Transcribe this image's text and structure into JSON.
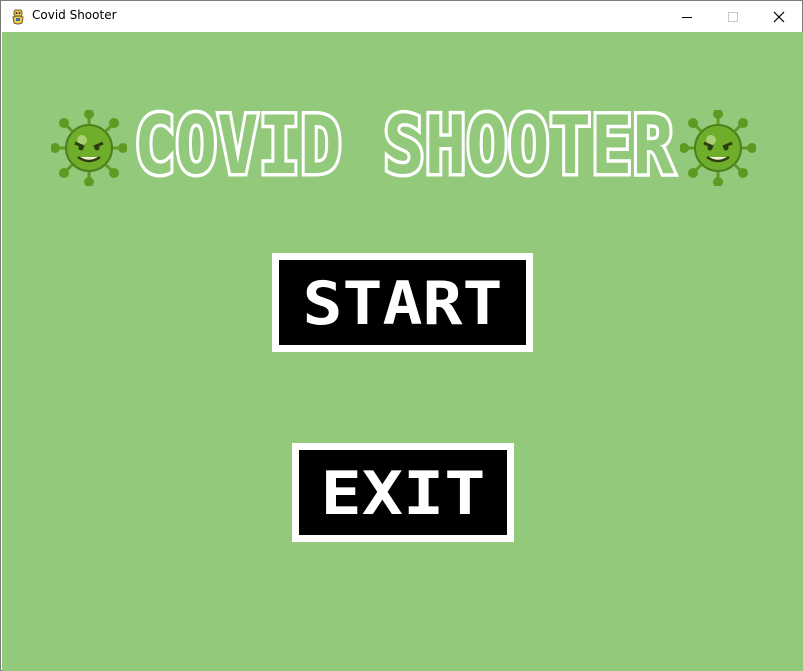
{
  "window": {
    "title": "Covid Shooter",
    "controls": {
      "minimize": "minimize",
      "maximize": "maximize",
      "close": "close"
    }
  },
  "game": {
    "title": "COVID SHOOTER",
    "background_color": "#93c97b",
    "virus_color": "#6fae2a",
    "menu": {
      "start_label": "START",
      "exit_label": "EXIT"
    }
  }
}
